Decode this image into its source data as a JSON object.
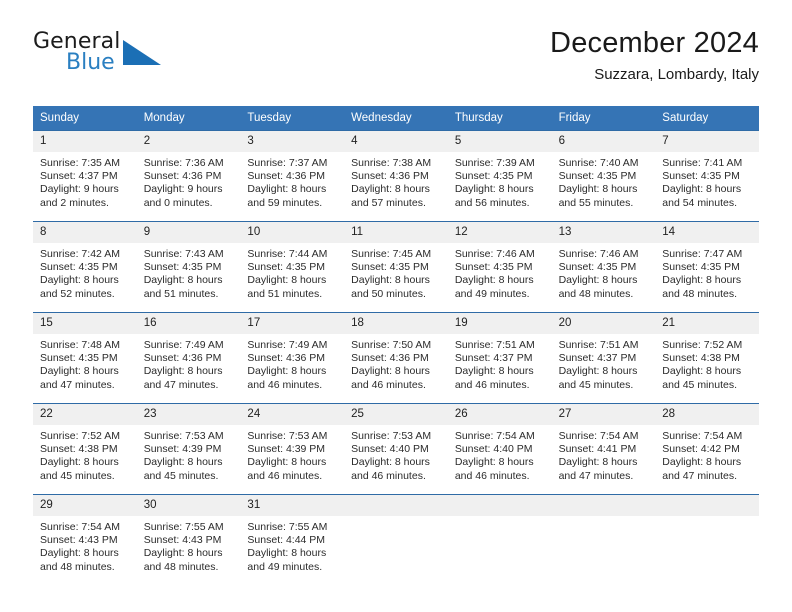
{
  "brand": {
    "name_part1": "General",
    "name_part2": "Blue",
    "logo_icon": "blue-triangle-logo"
  },
  "header": {
    "title": "December 2024",
    "subtitle": "Suzzara, Lombardy, Italy"
  },
  "colors": {
    "header_bar": "#3574b5",
    "row_divider": "#2f6ba6",
    "daynum_band": "#f0f0f0",
    "brand_blue": "#2a7fc1",
    "text": "#1a1a1a"
  },
  "weekdays": [
    "Sunday",
    "Monday",
    "Tuesday",
    "Wednesday",
    "Thursday",
    "Friday",
    "Saturday"
  ],
  "weeks": [
    [
      {
        "day": "1",
        "sunrise": "Sunrise: 7:35 AM",
        "sunset": "Sunset: 4:37 PM",
        "daylight1": "Daylight: 9 hours",
        "daylight2": "and 2 minutes."
      },
      {
        "day": "2",
        "sunrise": "Sunrise: 7:36 AM",
        "sunset": "Sunset: 4:36 PM",
        "daylight1": "Daylight: 9 hours",
        "daylight2": "and 0 minutes."
      },
      {
        "day": "3",
        "sunrise": "Sunrise: 7:37 AM",
        "sunset": "Sunset: 4:36 PM",
        "daylight1": "Daylight: 8 hours",
        "daylight2": "and 59 minutes."
      },
      {
        "day": "4",
        "sunrise": "Sunrise: 7:38 AM",
        "sunset": "Sunset: 4:36 PM",
        "daylight1": "Daylight: 8 hours",
        "daylight2": "and 57 minutes."
      },
      {
        "day": "5",
        "sunrise": "Sunrise: 7:39 AM",
        "sunset": "Sunset: 4:35 PM",
        "daylight1": "Daylight: 8 hours",
        "daylight2": "and 56 minutes."
      },
      {
        "day": "6",
        "sunrise": "Sunrise: 7:40 AM",
        "sunset": "Sunset: 4:35 PM",
        "daylight1": "Daylight: 8 hours",
        "daylight2": "and 55 minutes."
      },
      {
        "day": "7",
        "sunrise": "Sunrise: 7:41 AM",
        "sunset": "Sunset: 4:35 PM",
        "daylight1": "Daylight: 8 hours",
        "daylight2": "and 54 minutes."
      }
    ],
    [
      {
        "day": "8",
        "sunrise": "Sunrise: 7:42 AM",
        "sunset": "Sunset: 4:35 PM",
        "daylight1": "Daylight: 8 hours",
        "daylight2": "and 52 minutes."
      },
      {
        "day": "9",
        "sunrise": "Sunrise: 7:43 AM",
        "sunset": "Sunset: 4:35 PM",
        "daylight1": "Daylight: 8 hours",
        "daylight2": "and 51 minutes."
      },
      {
        "day": "10",
        "sunrise": "Sunrise: 7:44 AM",
        "sunset": "Sunset: 4:35 PM",
        "daylight1": "Daylight: 8 hours",
        "daylight2": "and 51 minutes."
      },
      {
        "day": "11",
        "sunrise": "Sunrise: 7:45 AM",
        "sunset": "Sunset: 4:35 PM",
        "daylight1": "Daylight: 8 hours",
        "daylight2": "and 50 minutes."
      },
      {
        "day": "12",
        "sunrise": "Sunrise: 7:46 AM",
        "sunset": "Sunset: 4:35 PM",
        "daylight1": "Daylight: 8 hours",
        "daylight2": "and 49 minutes."
      },
      {
        "day": "13",
        "sunrise": "Sunrise: 7:46 AM",
        "sunset": "Sunset: 4:35 PM",
        "daylight1": "Daylight: 8 hours",
        "daylight2": "and 48 minutes."
      },
      {
        "day": "14",
        "sunrise": "Sunrise: 7:47 AM",
        "sunset": "Sunset: 4:35 PM",
        "daylight1": "Daylight: 8 hours",
        "daylight2": "and 48 minutes."
      }
    ],
    [
      {
        "day": "15",
        "sunrise": "Sunrise: 7:48 AM",
        "sunset": "Sunset: 4:35 PM",
        "daylight1": "Daylight: 8 hours",
        "daylight2": "and 47 minutes."
      },
      {
        "day": "16",
        "sunrise": "Sunrise: 7:49 AM",
        "sunset": "Sunset: 4:36 PM",
        "daylight1": "Daylight: 8 hours",
        "daylight2": "and 47 minutes."
      },
      {
        "day": "17",
        "sunrise": "Sunrise: 7:49 AM",
        "sunset": "Sunset: 4:36 PM",
        "daylight1": "Daylight: 8 hours",
        "daylight2": "and 46 minutes."
      },
      {
        "day": "18",
        "sunrise": "Sunrise: 7:50 AM",
        "sunset": "Sunset: 4:36 PM",
        "daylight1": "Daylight: 8 hours",
        "daylight2": "and 46 minutes."
      },
      {
        "day": "19",
        "sunrise": "Sunrise: 7:51 AM",
        "sunset": "Sunset: 4:37 PM",
        "daylight1": "Daylight: 8 hours",
        "daylight2": "and 46 minutes."
      },
      {
        "day": "20",
        "sunrise": "Sunrise: 7:51 AM",
        "sunset": "Sunset: 4:37 PM",
        "daylight1": "Daylight: 8 hours",
        "daylight2": "and 45 minutes."
      },
      {
        "day": "21",
        "sunrise": "Sunrise: 7:52 AM",
        "sunset": "Sunset: 4:38 PM",
        "daylight1": "Daylight: 8 hours",
        "daylight2": "and 45 minutes."
      }
    ],
    [
      {
        "day": "22",
        "sunrise": "Sunrise: 7:52 AM",
        "sunset": "Sunset: 4:38 PM",
        "daylight1": "Daylight: 8 hours",
        "daylight2": "and 45 minutes."
      },
      {
        "day": "23",
        "sunrise": "Sunrise: 7:53 AM",
        "sunset": "Sunset: 4:39 PM",
        "daylight1": "Daylight: 8 hours",
        "daylight2": "and 45 minutes."
      },
      {
        "day": "24",
        "sunrise": "Sunrise: 7:53 AM",
        "sunset": "Sunset: 4:39 PM",
        "daylight1": "Daylight: 8 hours",
        "daylight2": "and 46 minutes."
      },
      {
        "day": "25",
        "sunrise": "Sunrise: 7:53 AM",
        "sunset": "Sunset: 4:40 PM",
        "daylight1": "Daylight: 8 hours",
        "daylight2": "and 46 minutes."
      },
      {
        "day": "26",
        "sunrise": "Sunrise: 7:54 AM",
        "sunset": "Sunset: 4:40 PM",
        "daylight1": "Daylight: 8 hours",
        "daylight2": "and 46 minutes."
      },
      {
        "day": "27",
        "sunrise": "Sunrise: 7:54 AM",
        "sunset": "Sunset: 4:41 PM",
        "daylight1": "Daylight: 8 hours",
        "daylight2": "and 47 minutes."
      },
      {
        "day": "28",
        "sunrise": "Sunrise: 7:54 AM",
        "sunset": "Sunset: 4:42 PM",
        "daylight1": "Daylight: 8 hours",
        "daylight2": "and 47 minutes."
      }
    ],
    [
      {
        "day": "29",
        "sunrise": "Sunrise: 7:54 AM",
        "sunset": "Sunset: 4:43 PM",
        "daylight1": "Daylight: 8 hours",
        "daylight2": "and 48 minutes."
      },
      {
        "day": "30",
        "sunrise": "Sunrise: 7:55 AM",
        "sunset": "Sunset: 4:43 PM",
        "daylight1": "Daylight: 8 hours",
        "daylight2": "and 48 minutes."
      },
      {
        "day": "31",
        "sunrise": "Sunrise: 7:55 AM",
        "sunset": "Sunset: 4:44 PM",
        "daylight1": "Daylight: 8 hours",
        "daylight2": "and 49 minutes."
      },
      {
        "day": "",
        "sunrise": "",
        "sunset": "",
        "daylight1": "",
        "daylight2": ""
      },
      {
        "day": "",
        "sunrise": "",
        "sunset": "",
        "daylight1": "",
        "daylight2": ""
      },
      {
        "day": "",
        "sunrise": "",
        "sunset": "",
        "daylight1": "",
        "daylight2": ""
      },
      {
        "day": "",
        "sunrise": "",
        "sunset": "",
        "daylight1": "",
        "daylight2": ""
      }
    ]
  ]
}
